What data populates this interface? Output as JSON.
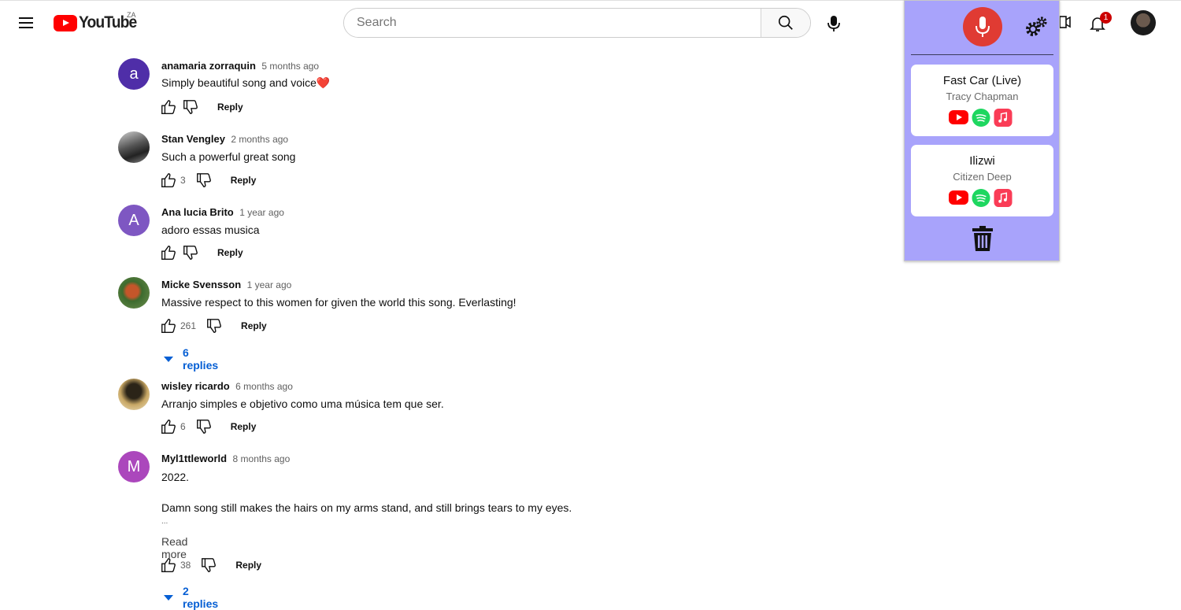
{
  "header": {
    "logo_text": "YouTube",
    "country_code": "ZA",
    "search_placeholder": "Search",
    "notification_count": "1"
  },
  "comments": [
    {
      "author": "anamaria zorraquin",
      "time": "5 months ago",
      "text": "Simply beautiful song and voice❤️",
      "likes": "",
      "avatar_letter": "a",
      "reply_label": "Reply"
    },
    {
      "author": "Stan Vengley",
      "time": "2 months ago",
      "text": "Such a powerful great song",
      "likes": "3",
      "avatar_letter": "",
      "reply_label": "Reply"
    },
    {
      "author": "Ana lucia Brito",
      "time": "1 year ago",
      "text": "adoro essas musica",
      "likes": "",
      "avatar_letter": "A",
      "reply_label": "Reply"
    },
    {
      "author": "Micke Svensson",
      "time": "1 year ago",
      "text": "Massive respect to this women for given the world this song. Everlasting!",
      "likes": "261",
      "avatar_letter": "",
      "reply_label": "Reply",
      "replies": "6 replies"
    },
    {
      "author": "wisley ricardo",
      "time": "6 months ago",
      "text": "Arranjo simples e objetivo como uma música tem que ser.",
      "likes": "6",
      "avatar_letter": "",
      "reply_label": "Reply"
    },
    {
      "author": "Myl1ttleworld",
      "time": "8 months ago",
      "text_lines": [
        "2022.",
        "Damn song still makes the hairs on my arms stand, and still brings tears to my eyes.",
        "..."
      ],
      "read_more": "Read more",
      "likes": "38",
      "avatar_letter": "M",
      "reply_label": "Reply",
      "replies": "2 replies"
    }
  ],
  "extension": {
    "songs": [
      {
        "title": "Fast Car (Live)",
        "artist": "Tracy Chapman"
      },
      {
        "title": "Ilizwi",
        "artist": "Citizen Deep"
      }
    ]
  },
  "colors": {
    "extension_bg": "#a8a3fb",
    "mic_red": "#e03b33",
    "youtube_red": "#ff0000",
    "spotify_green": "#1ed760",
    "apple_music_red": "#fa3c56",
    "link_blue": "#065fd4"
  },
  "icons": [
    "menu-icon",
    "youtube-logo-icon",
    "search-icon",
    "microphone-icon",
    "create-video-icon",
    "bell-icon",
    "gear-icon",
    "trash-icon",
    "like-icon",
    "dislike-icon",
    "spotify-icon",
    "apple-music-icon"
  ]
}
